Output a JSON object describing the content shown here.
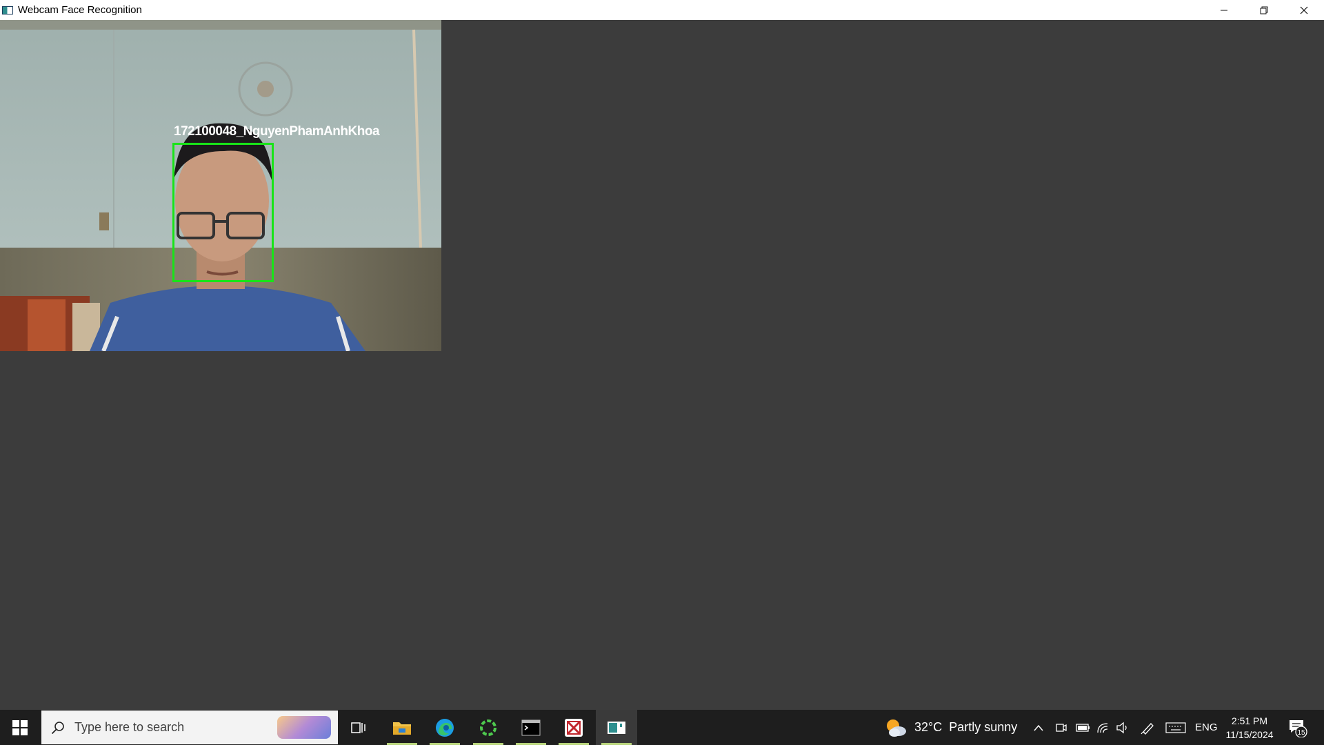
{
  "window": {
    "title": "Webcam Face Recognition",
    "minimize_icon": "minimize-icon",
    "restore_icon": "restore-icon",
    "close_icon": "close-icon"
  },
  "video": {
    "detection_label": "172100048_NguyenPhamAnhKhoa",
    "box_color": "#18e418"
  },
  "taskbar": {
    "search_placeholder": "Type here to search",
    "apps": [
      "task-view-icon",
      "file-explorer-icon",
      "edge-icon",
      "spinner-app-icon",
      "terminal-icon",
      "kali-app-icon",
      "webcam-app-icon"
    ],
    "weather_temp": "32°C",
    "weather_desc": "Partly sunny",
    "language": "ENG",
    "time": "2:51 PM",
    "date": "11/15/2024",
    "notification_count": "15"
  },
  "colors": {
    "taskbar_bg": "#1e1e1e",
    "window_bg": "#3c3c3c",
    "accent_underline": "#b9d57c"
  }
}
